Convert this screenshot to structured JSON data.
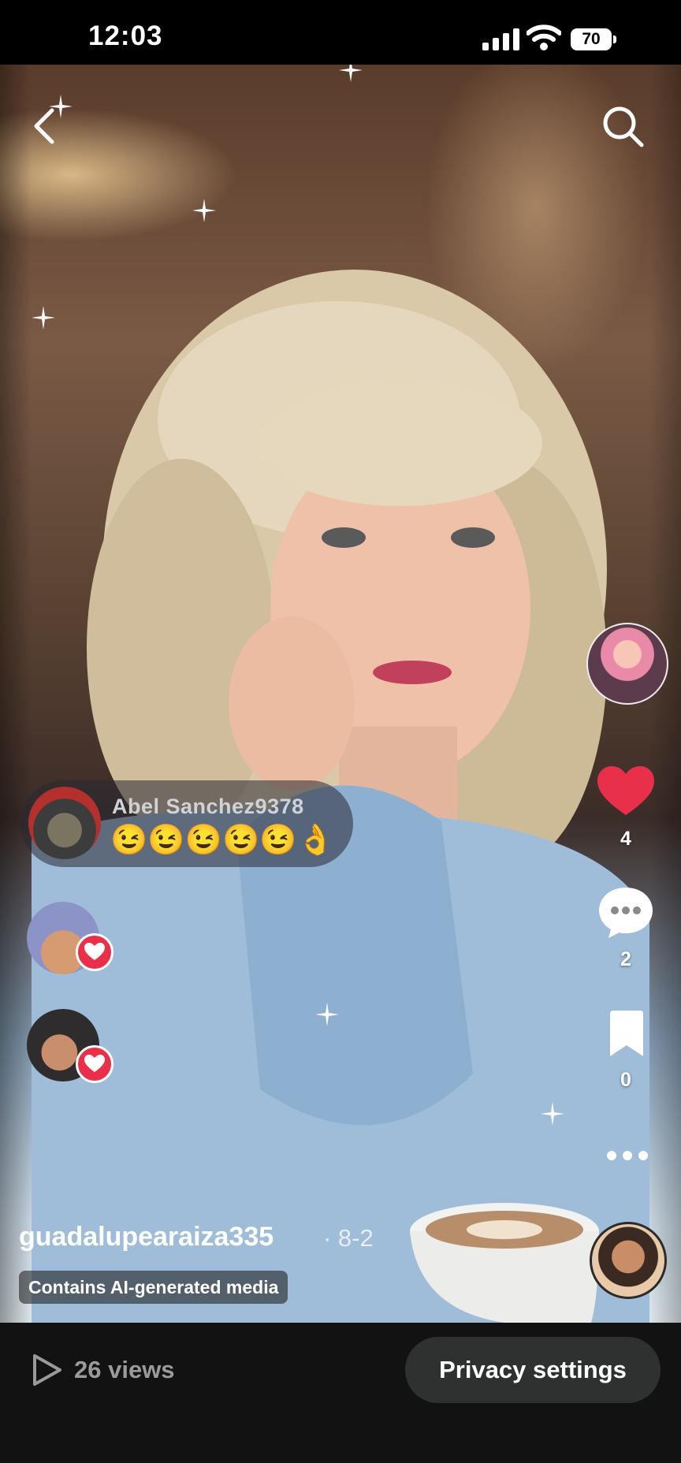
{
  "status_bar": {
    "time": "12:03",
    "battery": "70"
  },
  "comment": {
    "user": "Abel Sanchez9378",
    "text": "😉😉😉😉😉👌"
  },
  "actions": {
    "likes": "4",
    "comments": "2",
    "saves": "0"
  },
  "post": {
    "username": "guadalupearaiza335",
    "date": "· 8-2",
    "ai_label": "Contains AI-generated media"
  },
  "bottom": {
    "views": "26 views",
    "privacy_button": "Privacy settings"
  },
  "colors": {
    "like": "#e8304a",
    "bottom_bar": "#121212",
    "button": "#2f3131"
  }
}
